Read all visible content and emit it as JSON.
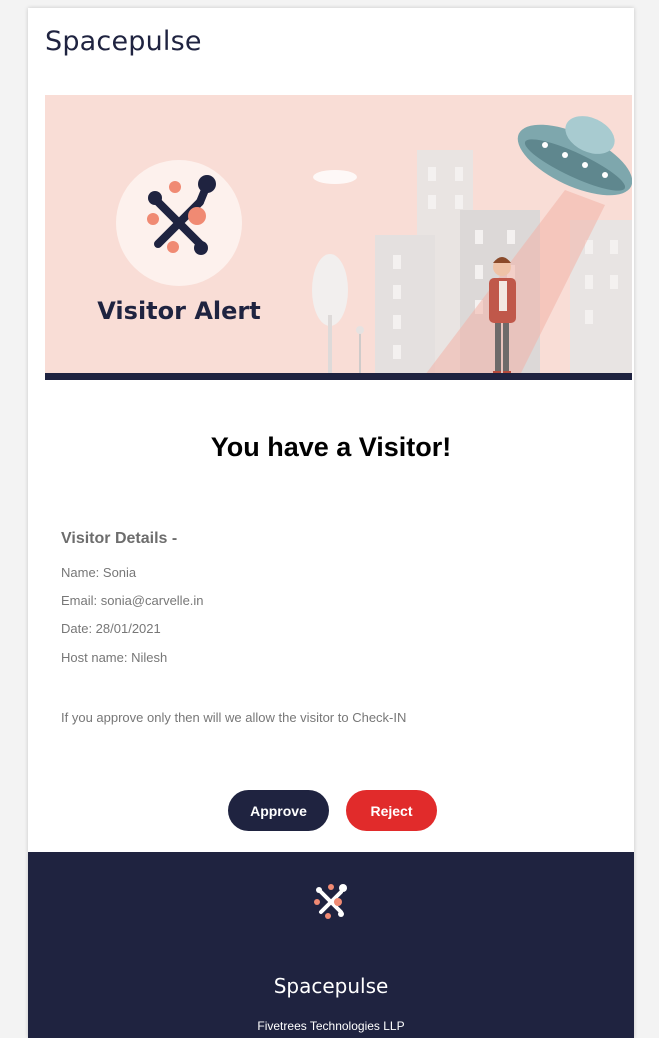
{
  "header": {
    "brand": "Spacepulse"
  },
  "banner": {
    "title": "Visitor Alert"
  },
  "main": {
    "headline": "You have a Visitor!",
    "details_title": "Visitor Details -",
    "details": [
      "Name: Sonia",
      "Email: sonia@carvelle.in",
      "Date: 28/01/2021",
      "Host name: Nilesh"
    ],
    "note": "If you approve only then will we allow the visitor to Check-IN"
  },
  "actions": {
    "approve_label": "Approve",
    "reject_label": "Reject"
  },
  "footer": {
    "brand": "Spacepulse",
    "company": "Fivetrees Technologies LLP"
  },
  "colors": {
    "navy": "#1f2340",
    "reject_red": "#e12b2b",
    "banner_bg": "#f9ddd6",
    "logo_dot": "#f08a73"
  },
  "icons": [
    "spacepulse-logo-icon",
    "ufo-illustration",
    "visitor-person-illustration"
  ]
}
